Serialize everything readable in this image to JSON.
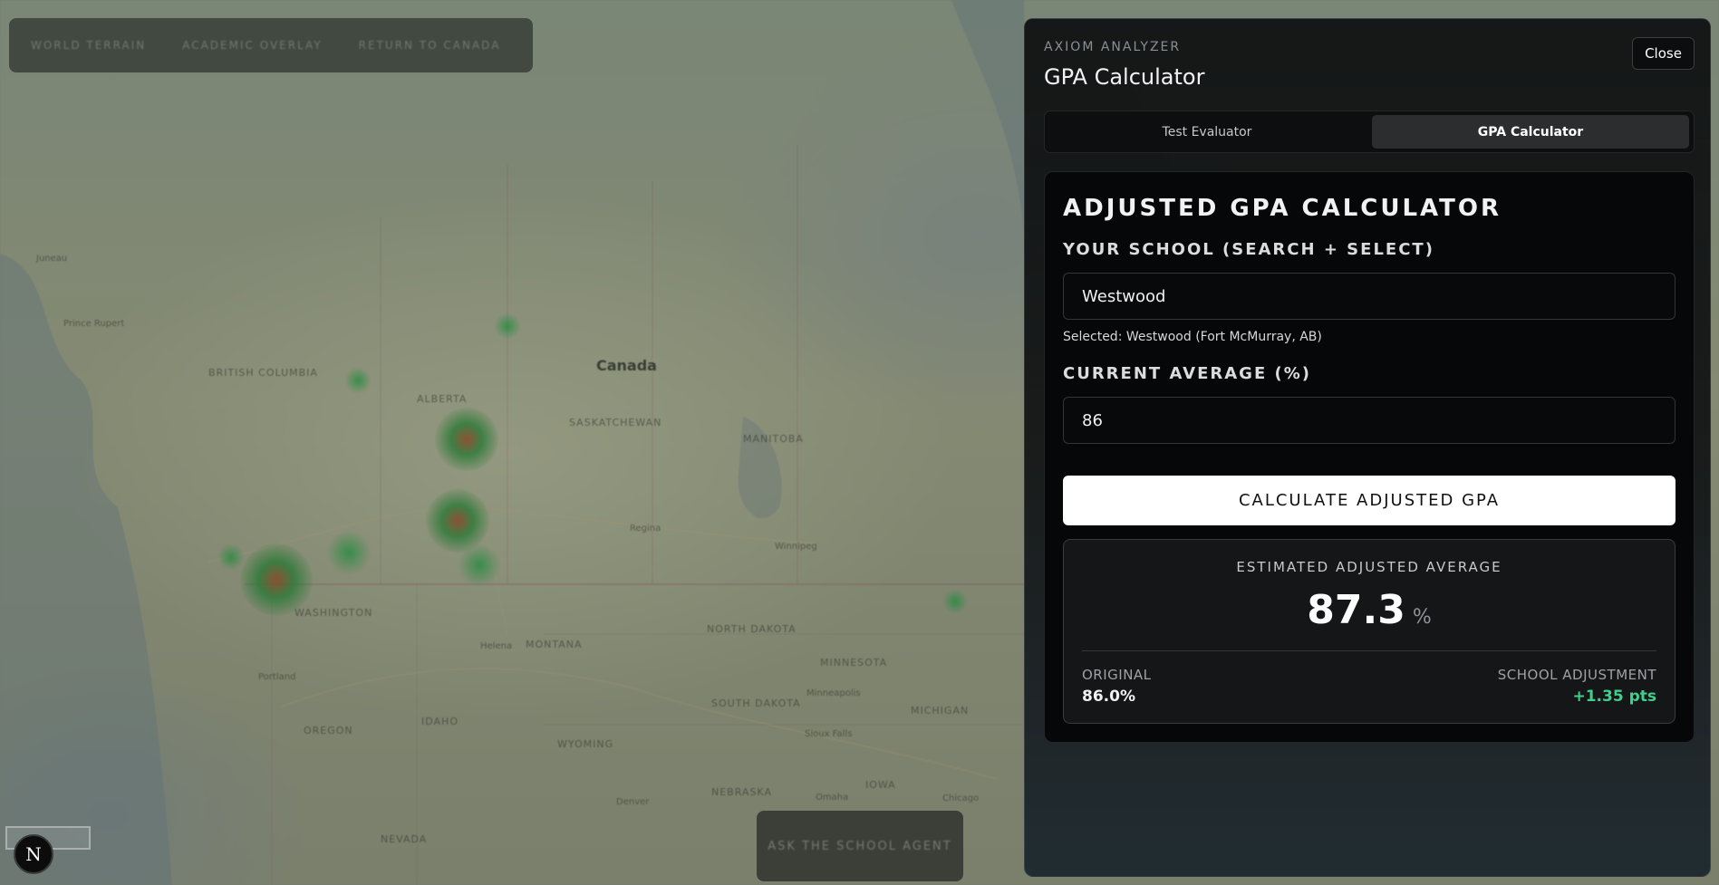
{
  "map": {
    "nav": [
      "WORLD TERRAIN",
      "ACADEMIC OVERLAY",
      "RETURN TO CANADA"
    ],
    "country_label": "Canada",
    "region_labels": [
      "BRITISH COLUMBIA",
      "ALBERTA",
      "SASKATCHEWAN",
      "MANITOBA",
      "WASHINGTON",
      "MONTANA",
      "NORTH DAKOTA",
      "MINNESOTA",
      "SOUTH DAKOTA",
      "OREGON",
      "IDAHO",
      "WYOMING",
      "NEBRASKA",
      "IOWA",
      "NEVADA",
      "MICHIGAN"
    ],
    "city_labels": [
      "Juneau",
      "Prince Rupert",
      "Regina",
      "Winnipeg",
      "Helena",
      "Portland",
      "Minneapolis",
      "Sioux Falls",
      "Omaha",
      "Chicago",
      "Denver"
    ],
    "agent_button": "ASK THE SCHOOL AGENT",
    "badge_letter": "N"
  },
  "panel": {
    "kicker": "AXIOM ANALYZER",
    "title": "GPA Calculator",
    "close_label": "Close",
    "tabs": [
      {
        "label": "Test Evaluator",
        "active": false
      },
      {
        "label": "GPA Calculator",
        "active": true
      }
    ]
  },
  "calculator": {
    "heading": "ADJUSTED GPA CALCULATOR",
    "school_label": "YOUR SCHOOL (SEARCH + SELECT)",
    "school_value": "Westwood",
    "selected_note": "Selected: Westwood (Fort McMurray, AB)",
    "average_label": "CURRENT AVERAGE (%)",
    "average_value": "86",
    "button_label": "CALCULATE ADJUSTED GPA",
    "result": {
      "label": "ESTIMATED ADJUSTED AVERAGE",
      "value": "87.3",
      "unit": "%",
      "original_label": "ORIGINAL",
      "original_value": "86.0%",
      "adjustment_label": "SCHOOL ADJUSTMENT",
      "adjustment_value": "+1.35 pts"
    }
  },
  "colors": {
    "accent_positive": "#3fd08a",
    "panel_bg": "#0f1112",
    "button_bg": "#ffffff"
  }
}
